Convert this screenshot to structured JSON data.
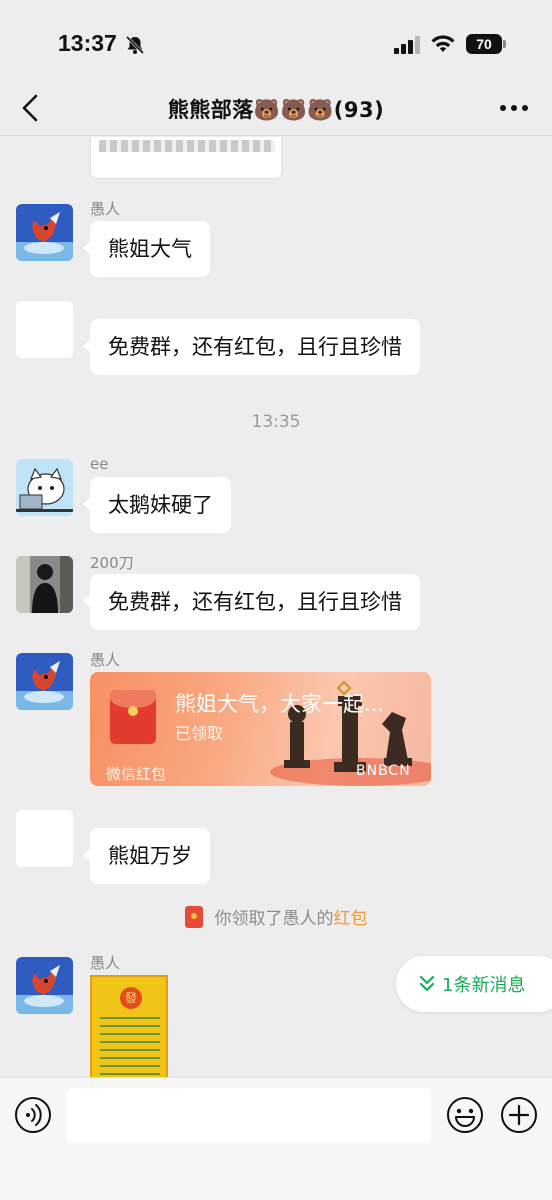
{
  "status_bar": {
    "time": "13:37",
    "battery": "70",
    "icons": [
      "bell-muted-icon",
      "signal-icon",
      "wifi-icon",
      "battery-icon"
    ]
  },
  "nav": {
    "title": "熊熊部落🐻🐻🐻(93)",
    "back_icon": "chevron-left-icon",
    "more_icon": "more-icon"
  },
  "messages": [
    {
      "sender": "愚人",
      "text": "熊姐大气",
      "avatar": "red-fox-avatar"
    },
    {
      "sender": "",
      "text": "免费群，还有红包，且行且珍惜",
      "avatar": "blank-avatar"
    },
    {
      "time_separator": "13:35"
    },
    {
      "sender": "ee",
      "text": "太鹅妹硬了",
      "avatar": "cat-laptop-avatar"
    },
    {
      "sender": "200刀",
      "text": "免费群，还有红包，且行且珍惜",
      "avatar": "man-dark-avatar"
    },
    {
      "sender": "愚人",
      "avatar": "red-fox-avatar"
    },
    {
      "sender": "",
      "text": "熊姐万岁",
      "avatar": "blank-avatar"
    },
    {
      "sender": "愚人",
      "avatar": "red-fox-avatar"
    }
  ],
  "red_packet": {
    "title": "熊姐大气，大家一起...",
    "status": "已领取",
    "footer": "微信红包",
    "brand": "BNBCN"
  },
  "system_message": {
    "prefix": "你领取了愚人的",
    "link": "红包"
  },
  "poster": {
    "glyph": "發"
  },
  "new_messages": {
    "label": "1条新消息"
  },
  "input": {
    "placeholder": ""
  },
  "colors": {
    "background": "#ededed",
    "bubble": "#ffffff",
    "accent_green": "#1aad5a",
    "link_orange": "#f19a38",
    "red_packet": "#f79063"
  }
}
